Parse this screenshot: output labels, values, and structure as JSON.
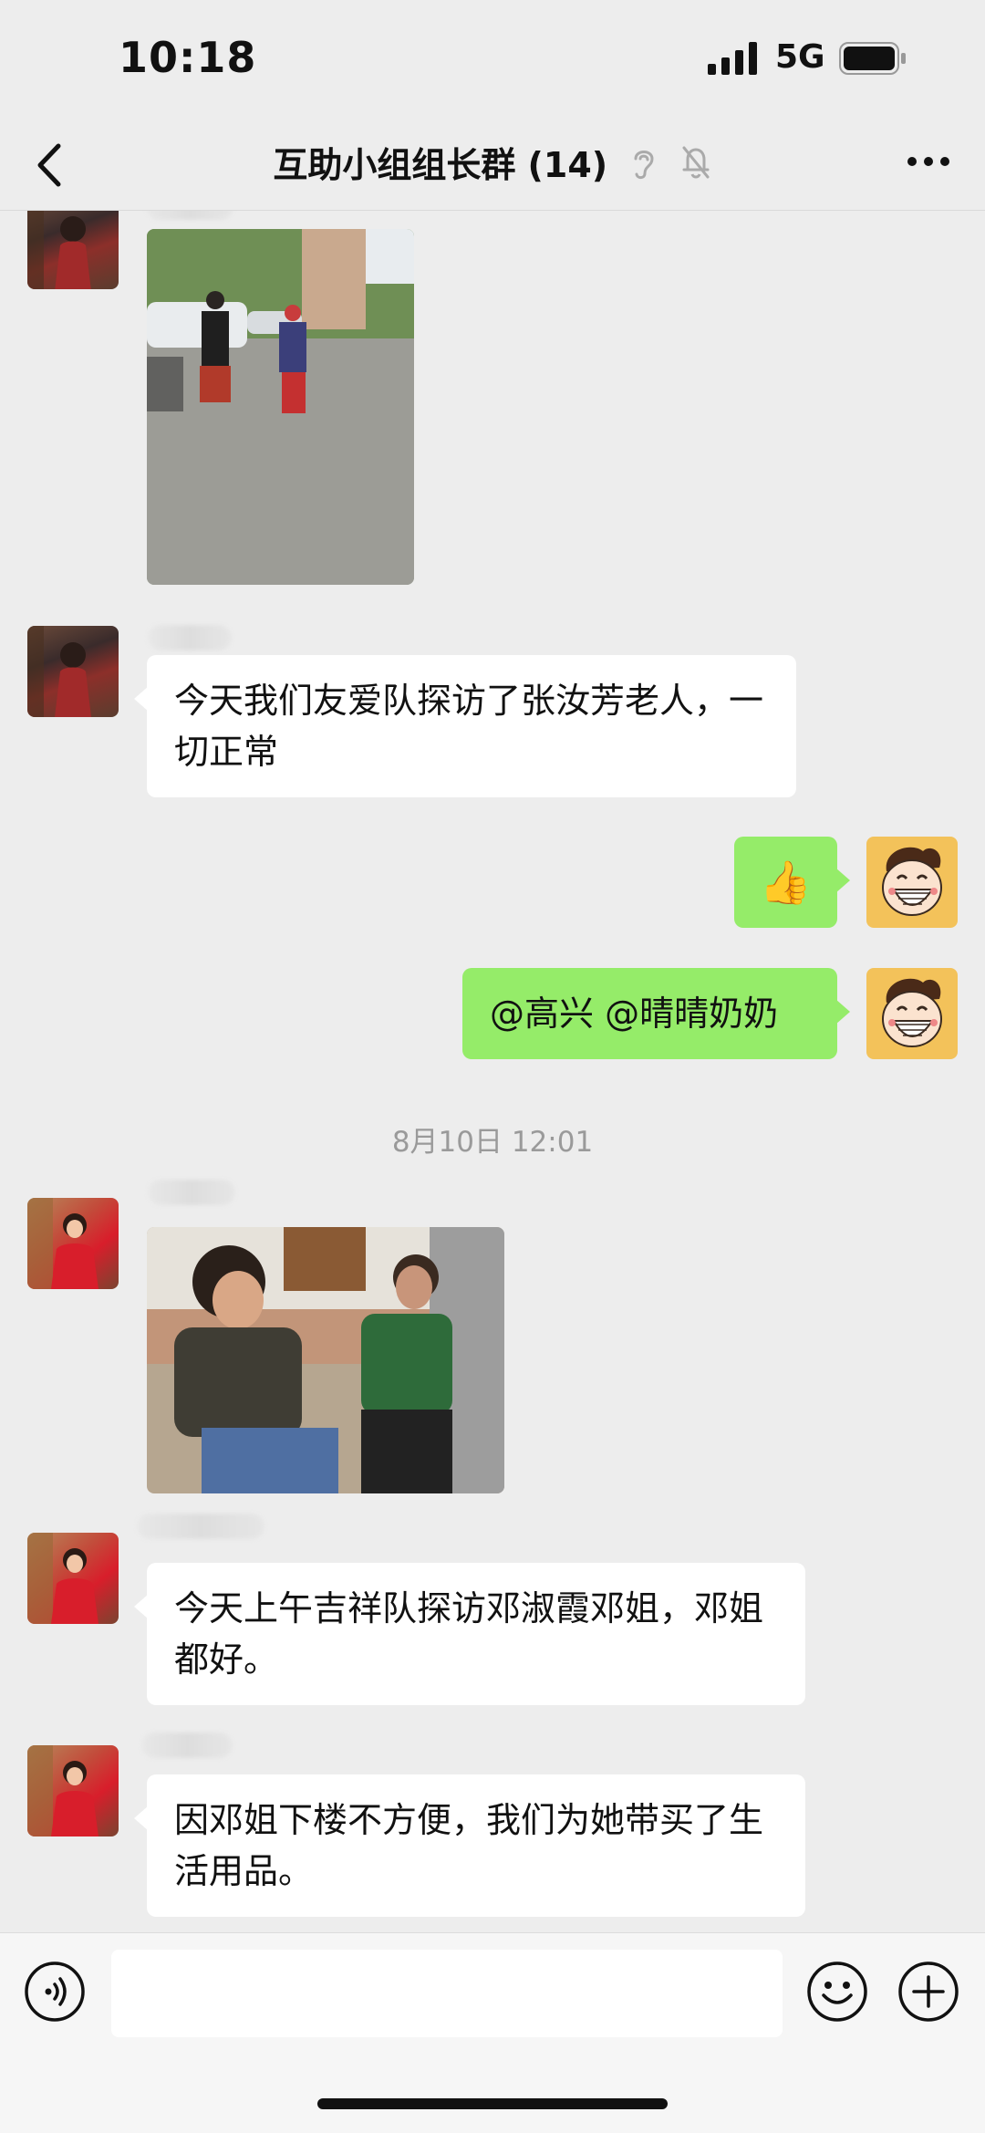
{
  "status": {
    "time": "10:18",
    "network": "5G"
  },
  "nav": {
    "title": "互助小组组长群 (14)"
  },
  "messages": {
    "m2": "今天我们友爱队探访了张汝芳老人，一切正常",
    "m3_emoji": "👍",
    "m4": "@高兴 @晴晴奶奶",
    "ts1": "8月10日 12:01",
    "m6": "今天上午吉祥队探访邓淑霞邓姐，邓姐都好。",
    "m7": "因邓姐下楼不方便，我们为她带买了生活用品。"
  },
  "icons": {
    "back": "chevron-left-icon",
    "ear": "ear-icon",
    "mute": "bell-mute-icon",
    "more": "more-icon",
    "voice": "voice-icon",
    "emoji": "emoji-icon",
    "plus": "plus-icon"
  },
  "colors": {
    "outgoing_bubble": "#95ec69",
    "incoming_bubble": "#ffffff",
    "background": "#ededed"
  }
}
